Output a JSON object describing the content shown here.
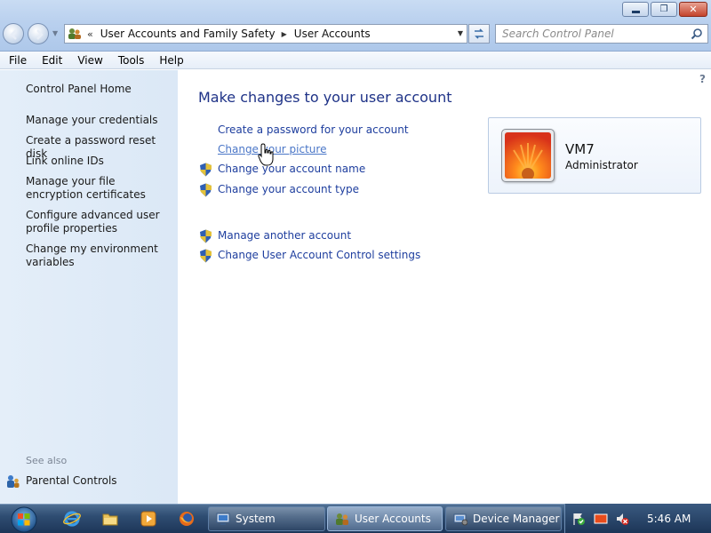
{
  "window": {
    "minimize_glyph": "",
    "maximize_glyph": "❐",
    "close_glyph": "✕"
  },
  "nav": {
    "crumb_overflow": "«",
    "breadcrumbs": [
      "User Accounts and Family Safety",
      "User Accounts"
    ],
    "search_placeholder": "Search Control Panel"
  },
  "menu": [
    "File",
    "Edit",
    "View",
    "Tools",
    "Help"
  ],
  "sidebar": {
    "home": "Control Panel Home",
    "links": [
      "Manage your credentials",
      "Create a password reset disk",
      "Link online IDs",
      "Manage your file encryption certificates",
      "Configure advanced user profile properties",
      "Change my environment variables"
    ],
    "see_also_label": "See also",
    "see_also_links": [
      "Parental Controls"
    ]
  },
  "main": {
    "help_glyph": "?",
    "title": "Make changes to your user account",
    "tasks": [
      {
        "label": "Create a password for your account",
        "shield": false
      },
      {
        "label": "Change your picture",
        "shield": false
      },
      {
        "label": "Change your account name",
        "shield": true
      },
      {
        "label": "Change your account type",
        "shield": true
      }
    ],
    "other_tasks": [
      {
        "label": "Manage another account",
        "shield": true
      },
      {
        "label": "Change User Account Control settings",
        "shield": true
      }
    ]
  },
  "user": {
    "name": "VM7",
    "role": "Administrator"
  },
  "taskbar": {
    "quick_launch": [
      "ie-icon",
      "explorer-folder-icon",
      "media-player-icon",
      "firefox-icon"
    ],
    "buttons": [
      {
        "label": "System",
        "active": false
      },
      {
        "label": "User Accounts",
        "active": true
      },
      {
        "label": "Device Manager",
        "active": false
      }
    ],
    "clock": "5:46 AM"
  },
  "colors": {
    "link": "#1e3e9e",
    "title": "#1e3287",
    "sidebar_bg": "#dbe8f6",
    "taskbar": "#2f4d72"
  }
}
